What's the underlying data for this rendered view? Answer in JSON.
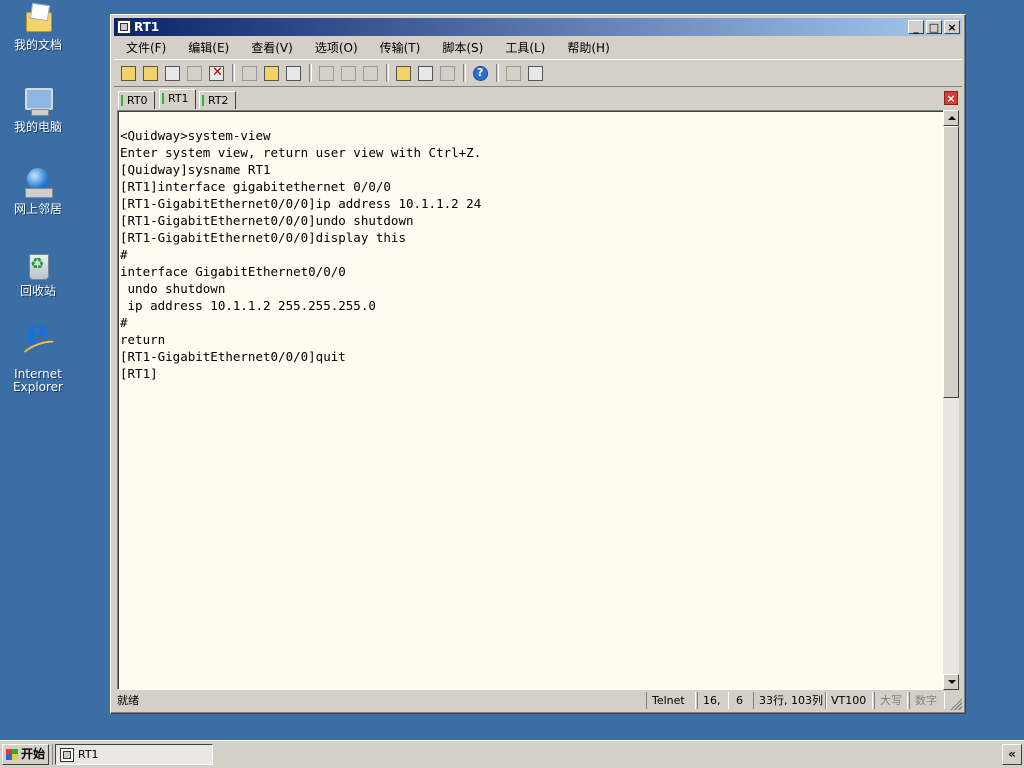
{
  "desktop": {
    "icons": [
      {
        "label": "我的文档",
        "icon": "my-documents-icon"
      },
      {
        "label": "我的电脑",
        "icon": "my-computer-icon"
      },
      {
        "label": "网上邻居",
        "icon": "network-places-icon"
      },
      {
        "label": "回收站",
        "icon": "recycle-bin-icon"
      },
      {
        "label_line1": "Internet",
        "label_line2": "Explorer",
        "icon": "internet-explorer-icon"
      }
    ]
  },
  "window": {
    "title": "RT1",
    "controls": {
      "minimize": "_",
      "maximize": "□",
      "close": "×"
    }
  },
  "menu": [
    "文件(F)",
    "编辑(E)",
    "查看(V)",
    "选项(O)",
    "传输(T)",
    "脚本(S)",
    "工具(L)",
    "帮助(H)"
  ],
  "tabs": [
    {
      "label": "RT0",
      "active": false
    },
    {
      "label": "RT1",
      "active": true
    },
    {
      "label": "RT2",
      "active": false
    }
  ],
  "terminal": {
    "lines": [
      "<Quidway>system-view",
      "Enter system view, return user view with Ctrl+Z.",
      "[Quidway]sysname RT1",
      "[RT1]interface gigabitethernet 0/0/0",
      "[RT1-GigabitEthernet0/0/0]ip address 10.1.1.2 24",
      "[RT1-GigabitEthernet0/0/0]undo shutdown",
      "[RT1-GigabitEthernet0/0/0]display this",
      "#",
      "interface GigabitEthernet0/0/0",
      " undo shutdown",
      " ip address 10.1.1.2 255.255.255.0",
      "#",
      "return",
      "[RT1-GigabitEthernet0/0/0]quit",
      "[RT1]"
    ]
  },
  "statusbar": {
    "ready": "就绪",
    "protocol": "Telnet",
    "cursor_row": "16,",
    "cursor_col": "6",
    "size": "33行, 103列",
    "emulation": "VT100",
    "caps": "大写",
    "num": "数字"
  },
  "taskbar": {
    "start": "开始",
    "task": "RT1",
    "tray_toggle": "«"
  }
}
